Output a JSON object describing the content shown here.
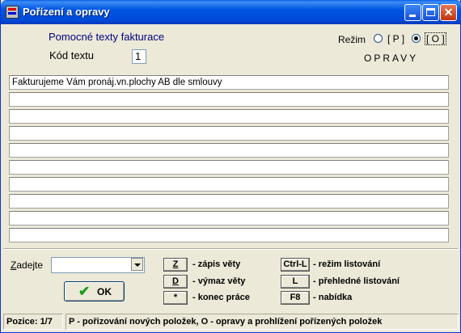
{
  "window": {
    "title": "Pořízení a opravy",
    "close_glyph": "✕"
  },
  "header": {
    "heading": "Pomocné texty fakturace",
    "kod_label": "Kód textu",
    "kod_value": "1"
  },
  "mode": {
    "label": "Režim",
    "option_p": "[ P ]",
    "option_o": "[ O ]",
    "selected": "O",
    "status": "OPRAVY"
  },
  "rows": [
    "Fakturujeme Vám pronáj.vn.plochy AB dle smlouvy",
    "",
    "",
    "",
    "",
    "",
    "",
    "",
    "",
    ""
  ],
  "bottom": {
    "zadejte_underlined": "Z",
    "zadejte_rest": "adejte",
    "combo_value": "",
    "ok_label": "OK"
  },
  "shortcuts": {
    "z_key": "Z",
    "z_text": "- zápis věty",
    "d_key": "D",
    "d_text": "- výmaz věty",
    "star_key": "*",
    "star_text": "- konec práce",
    "ctrll_key": "Ctrl-L",
    "ctrll_text": "- režim listování",
    "l_key": "L",
    "l_text": "- přehledné listování",
    "f8_key": "F8",
    "f8_text": "- nabídka"
  },
  "statusbar": {
    "pozice": "Pozice: 1/7",
    "help": "P - pořizování nových položek, O - opravy a prohlížení pořízených položek"
  },
  "colors": {
    "titlebar": "#0055e3",
    "heading": "#00007f",
    "ok_check": "#1a9e1a"
  }
}
